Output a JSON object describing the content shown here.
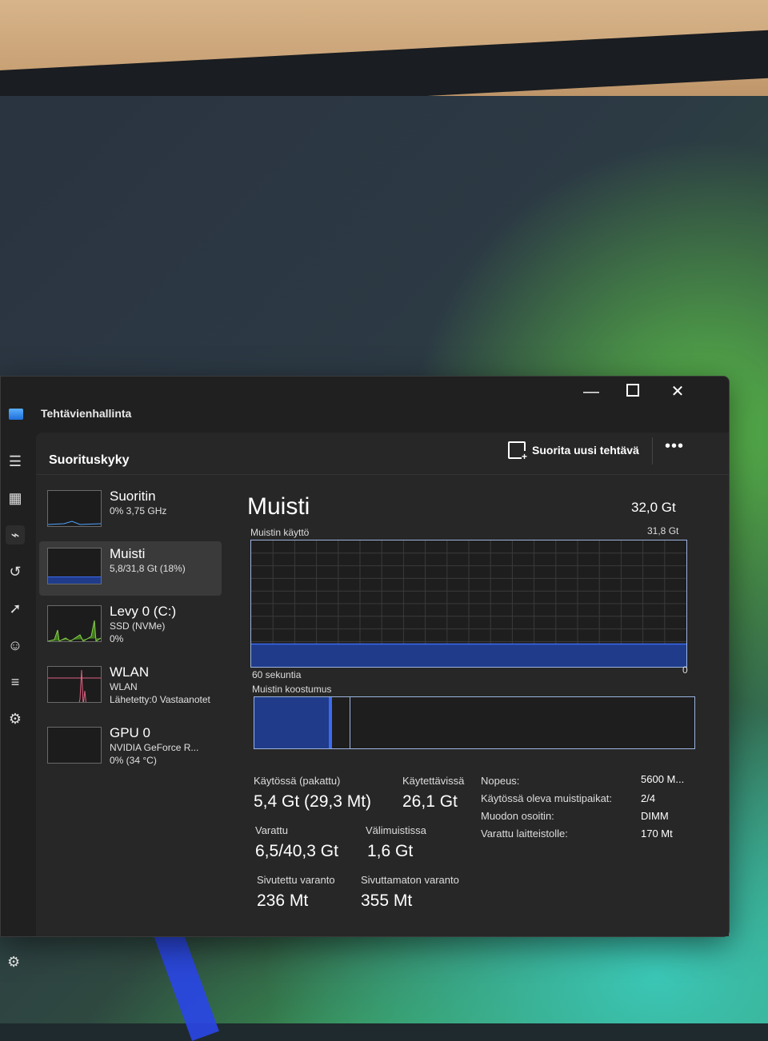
{
  "window": {
    "title": "Tehtävienhallinta",
    "controls": {
      "minimize": "—",
      "maximize": "",
      "close": "✕"
    }
  },
  "header": {
    "page_title": "Suorituskyky",
    "run_task_label": "Suorita uusi tehtävä",
    "more_label": "•••"
  },
  "devices": [
    {
      "name": "Suoritin",
      "line1": "0% 3,75 GHz",
      "line2": ""
    },
    {
      "name": "Muisti",
      "line1": "5,8/31,8 Gt (18%)",
      "line2": ""
    },
    {
      "name": "Levy 0 (C:)",
      "line1": "SSD (NVMe)",
      "line2": "0%"
    },
    {
      "name": "WLAN",
      "line1": "WLAN",
      "line2": "Lähetetty:0 Vastaanotet"
    },
    {
      "name": "GPU 0",
      "line1": "NVIDIA GeForce R...",
      "line2": "0% (34 °C)"
    }
  ],
  "memory": {
    "title": "Muisti",
    "total": "32,0 Gt",
    "usage_label": "Muistin käyttö",
    "usage_max": "31,8 Gt",
    "graph_left_label": "60 sekuntia",
    "graph_right_label": "0",
    "usage_fraction": 0.18,
    "composition_label": "Muistin koostumus",
    "stats": {
      "in_use_label": "Käytössä (pakattu)",
      "in_use_value": "5,4 Gt (29,3 Mt)",
      "available_label": "Käytettävissä",
      "available_value": "26,1 Gt",
      "committed_label": "Varattu",
      "committed_value": "6,5/40,3 Gt",
      "cached_label": "Välimuistissa",
      "cached_value": "1,6 Gt",
      "paged_label": "Sivutettu varanto",
      "paged_value": "236 Mt",
      "nonpaged_label": "Sivuttamaton varanto",
      "nonpaged_value": "355 Mt"
    },
    "details": {
      "speed_label": "Nopeus:",
      "speed_value": "5600 M...",
      "slots_label": "Käytössä oleva muistipaikat:",
      "slots_value": "2/4",
      "form_label": "Muodon osoitin:",
      "form_value": "DIMM",
      "reserved_label": "Varattu laitteistolle:",
      "reserved_value": "170 Mt"
    }
  },
  "colors": {
    "window_bg": "#202020",
    "pane_bg": "#272727",
    "graph_border": "#9cb4e0",
    "memory_fill": "#1f3b8a",
    "memory_line": "#3c6af0"
  }
}
